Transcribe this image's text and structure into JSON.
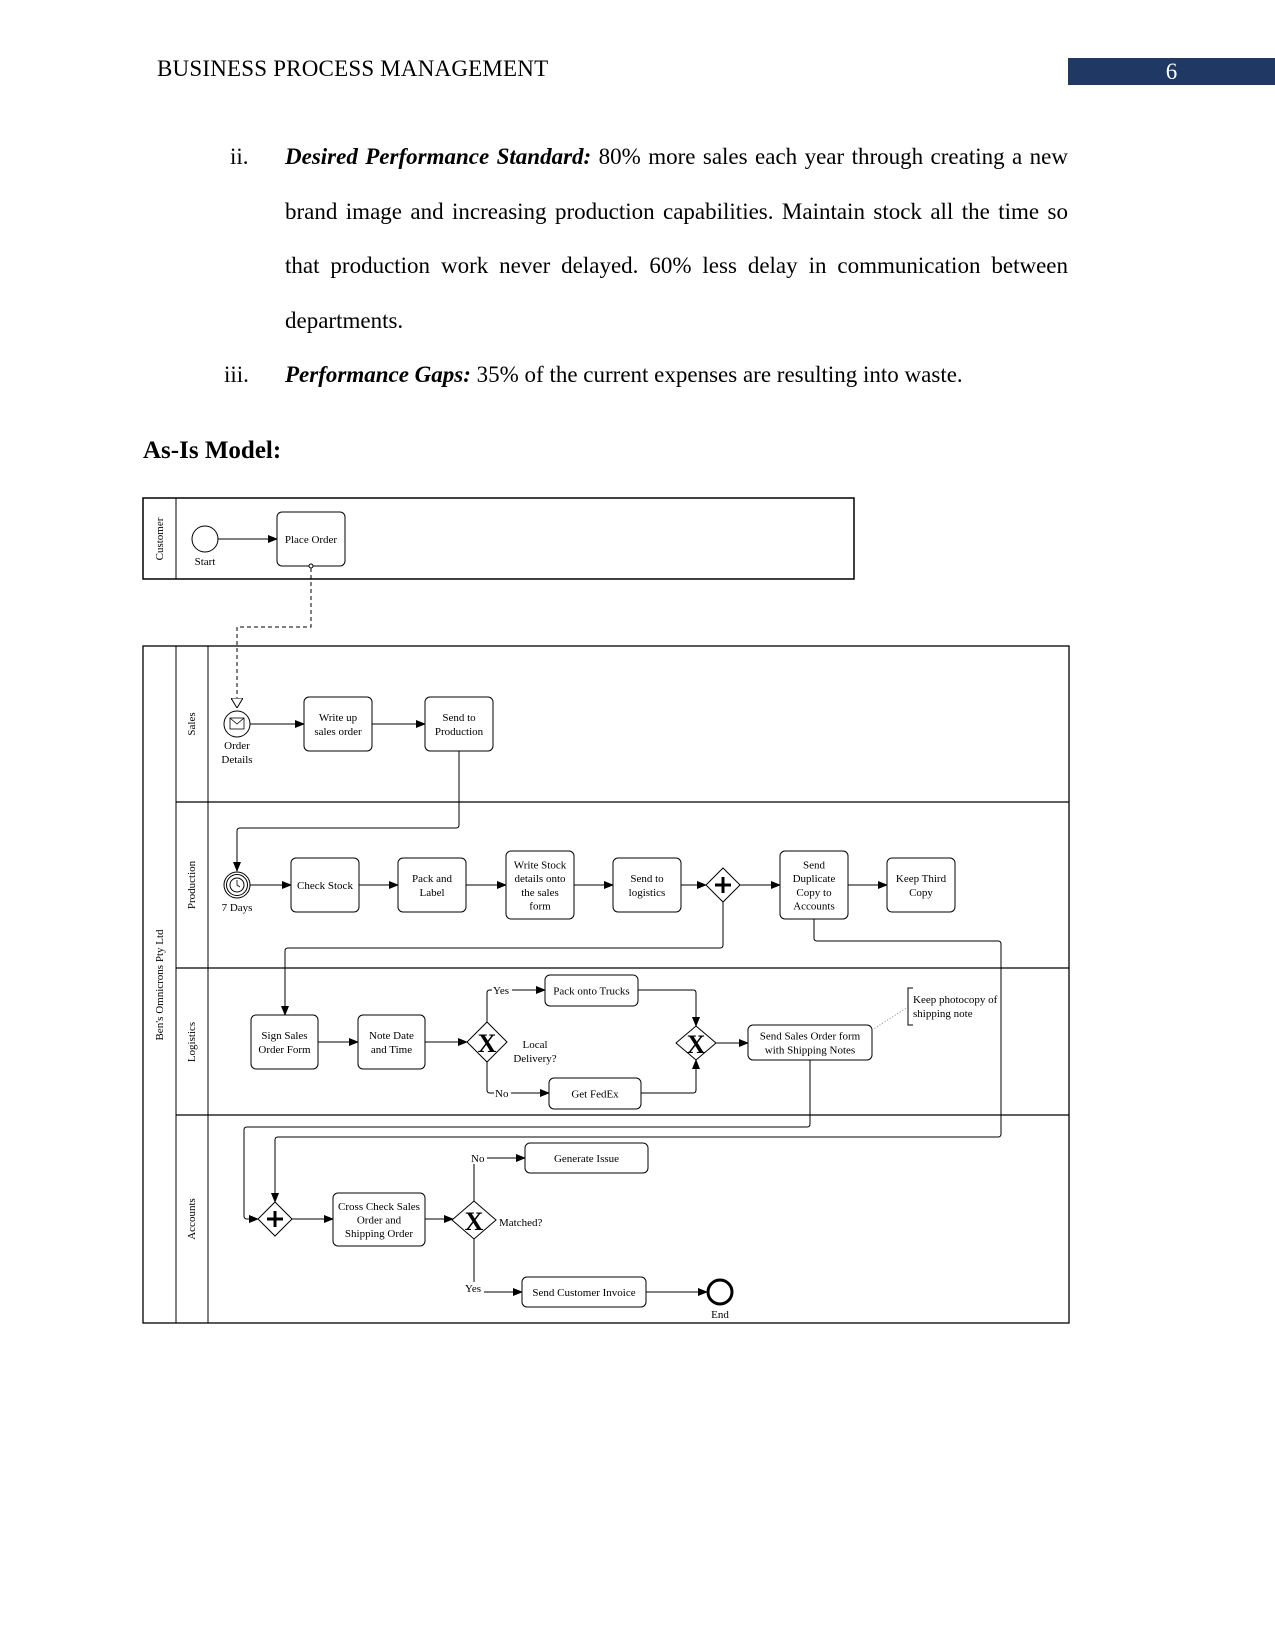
{
  "header": {
    "running_title": "BUSINESS PROCESS MANAGEMENT",
    "page_number": "6",
    "accent_color": "#1f3864"
  },
  "list": [
    {
      "marker": "ii.",
      "label": "Desired Performance Standard:",
      "text": " 80% more sales each year through creating a new brand image and increasing production capabilities. Maintain stock all the time so that production work never delayed. 60% less delay in communication between departments."
    },
    {
      "marker": "iii.",
      "label": "Performance Gaps:",
      "text": " 35% of the current expenses are resulting into waste."
    }
  ],
  "section_heading": "As-Is Model:",
  "diagram": {
    "pools": {
      "customer": "Customer",
      "company": "Ben's Omnicrons Pty Ltd"
    },
    "lanes": {
      "sales": "Sales",
      "production": "Production",
      "logistics": "Logistics",
      "accounts": "Accounts"
    },
    "events": {
      "start": "Start",
      "order_details": [
        "Order",
        "Details"
      ],
      "timer": "7 Days",
      "end": "End"
    },
    "tasks": {
      "place_order": [
        "Place Order"
      ],
      "write_up_sales_order": [
        "Write up",
        "sales order"
      ],
      "send_to_production": [
        "Send to",
        "Production"
      ],
      "check_stock": [
        "Check Stock"
      ],
      "pack_and_label": [
        "Pack and",
        "Label"
      ],
      "write_stock_details": [
        "Write Stock",
        "details onto",
        "the sales",
        "form"
      ],
      "send_to_logistics": [
        "Send to",
        "logistics"
      ],
      "send_duplicate_copy": [
        "Send",
        "Duplicate",
        "Copy to",
        "Accounts"
      ],
      "keep_third_copy": [
        "Keep Third",
        "Copy"
      ],
      "sign_sales_order_form": [
        "Sign Sales",
        "Order Form"
      ],
      "note_date_time": [
        "Note Date",
        "and Time"
      ],
      "pack_onto_trucks": [
        "Pack onto Trucks"
      ],
      "get_fedex": [
        "Get FedEx"
      ],
      "send_sales_order_form": [
        "Send Sales Order form",
        "with Shipping Notes"
      ],
      "cross_check": [
        "Cross Check Sales",
        "Order and",
        "Shipping Order"
      ],
      "generate_issue": [
        "Generate Issue"
      ],
      "send_customer_invoice": [
        "Send Customer Invoice"
      ]
    },
    "gateways": {
      "local_delivery": [
        "Local",
        "Delivery?"
      ],
      "matched": "Matched?"
    },
    "flow_labels": {
      "yes_delivery": "Yes",
      "no_delivery": "No",
      "no_matched": "No",
      "yes_matched": "Yes"
    },
    "annotation": [
      "Keep photocopy of",
      "shipping note"
    ]
  }
}
